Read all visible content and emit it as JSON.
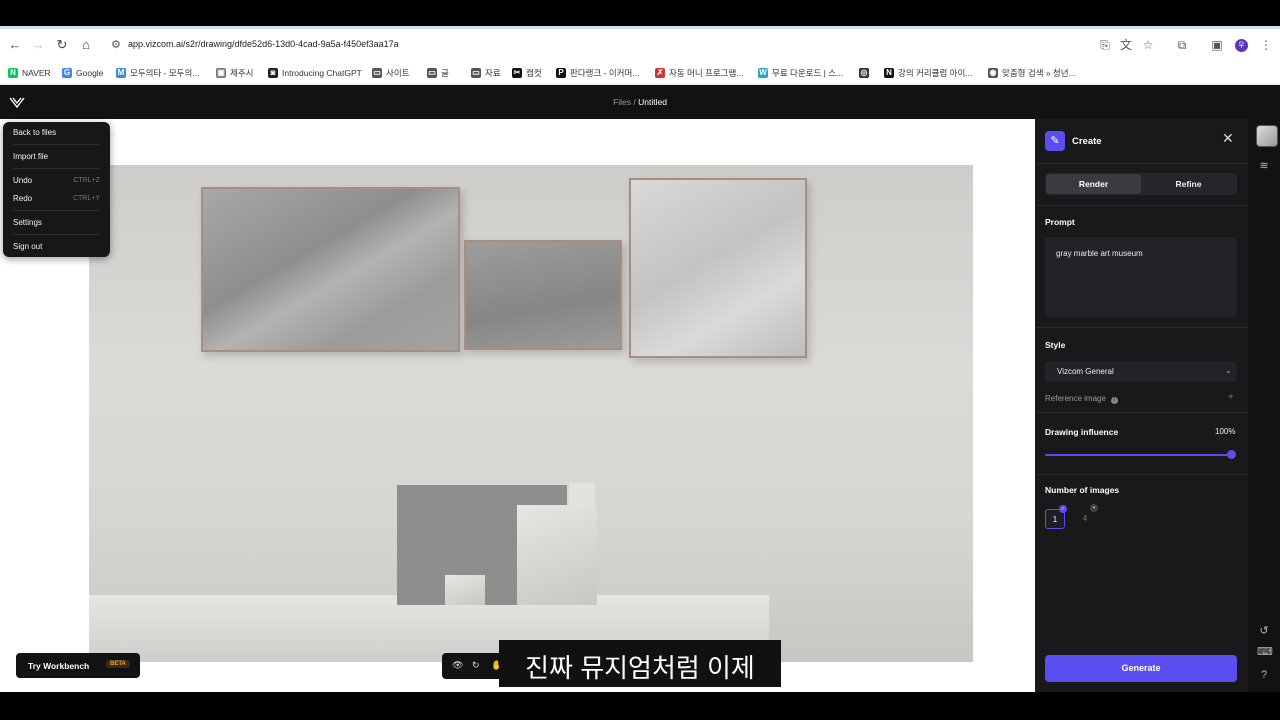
{
  "browser": {
    "url": "app.vizcom.ai/s2r/drawing/dfde52d6-13d0-4cad-9a5a-f450ef3aa17a",
    "profile_initial": "우",
    "bookmarks": [
      {
        "label": "NAVER",
        "color": "#03c75a",
        "glyph": "N"
      },
      {
        "label": "Google",
        "color": "#4285f4",
        "glyph": "G"
      },
      {
        "label": "모두의타 - 모두의...",
        "color": "#3a8fd0",
        "glyph": "M"
      },
      {
        "label": "제주시",
        "color": "#777777",
        "glyph": "▣"
      },
      {
        "label": "Introducing ChatGPT",
        "color": "#222222",
        "glyph": "◙"
      },
      {
        "label": "사이트",
        "color": "#555555",
        "glyph": "▭"
      },
      {
        "label": "글",
        "color": "#555555",
        "glyph": "▭"
      },
      {
        "label": "자료",
        "color": "#555555",
        "glyph": "▭"
      },
      {
        "label": "캡컷",
        "color": "#111111",
        "glyph": "✂"
      },
      {
        "label": "판다랭크 - 이커머...",
        "color": "#111111",
        "glyph": "P"
      },
      {
        "label": "자동 머니 프로그램...",
        "color": "#d33333",
        "glyph": "✗"
      },
      {
        "label": "무료 다운로드 | 스...",
        "color": "#2aa3c7",
        "glyph": "W"
      },
      {
        "label": "",
        "color": "#333333",
        "glyph": "◎"
      },
      {
        "label": "강의 커리큘럼 아이...",
        "color": "#111111",
        "glyph": "N"
      },
      {
        "label": "맞춤형 검색 » 청년...",
        "color": "#555555",
        "glyph": "◉"
      }
    ]
  },
  "app": {
    "breadcrumb_parent": "Files /",
    "breadcrumb_current": "Untitled"
  },
  "menu": {
    "items": [
      {
        "label": "Back to files",
        "shortcut": ""
      },
      {
        "label": "Import file",
        "shortcut": ""
      },
      {
        "label": "Undo",
        "shortcut": "CTRL+Z"
      },
      {
        "label": "Redo",
        "shortcut": "CTRL+Y"
      },
      {
        "label": "Settings",
        "shortcut": ""
      },
      {
        "label": "Sign out",
        "shortcut": ""
      }
    ]
  },
  "bottom": {
    "workbench_label": "Try Workbench",
    "beta_badge": "BETA",
    "subtitle": "진짜 뮤지엄처럼 이제"
  },
  "panel": {
    "title": "Create",
    "tabs": [
      "Render",
      "Refine"
    ],
    "active_tab": "Render",
    "prompt_label": "Prompt",
    "prompt_value": "gray marble art museum",
    "style_label": "Style",
    "style_value": "Vizcom General",
    "reference_label": "Reference image",
    "influence_label": "Drawing influence",
    "influence_value": "100%",
    "influence_fraction": 1.0,
    "images_label": "Number of images",
    "image_options": [
      "1",
      "4"
    ],
    "selected_images": "1",
    "generate_label": "Generate",
    "accent_color": "#5b4ef0"
  }
}
